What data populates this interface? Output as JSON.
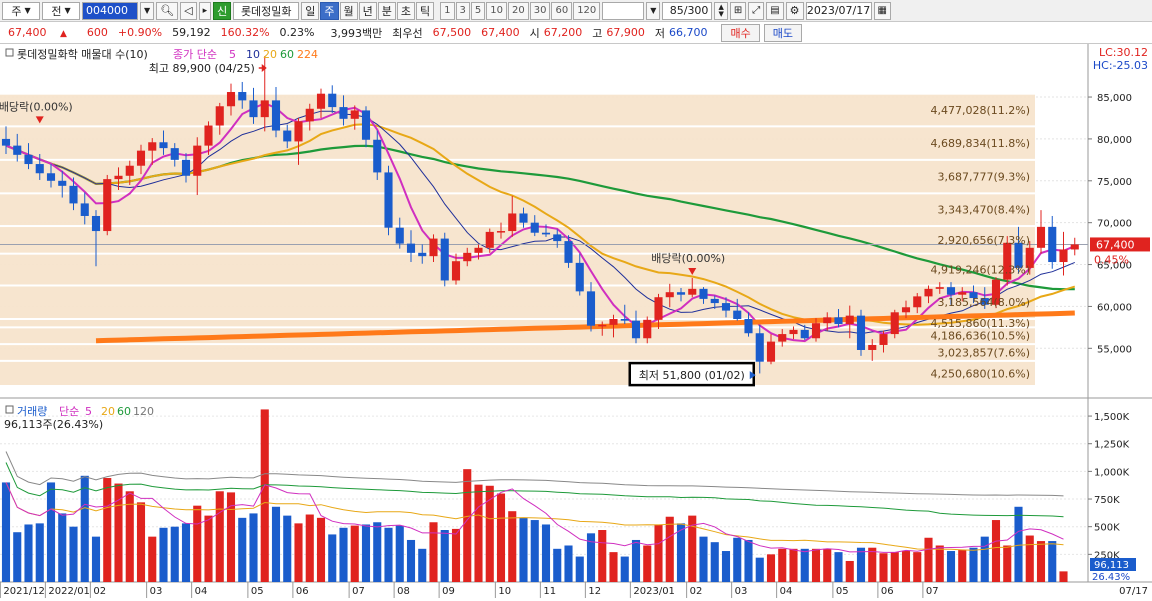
{
  "toolbar": {
    "market_type": "주",
    "market_sel": "전",
    "code": "004000",
    "credit_badge": "신",
    "stock_name": "롯데정밀화",
    "periods": [
      "일",
      "주",
      "월",
      "년",
      "분",
      "초",
      "틱"
    ],
    "active_period": "주",
    "intervals": [
      "1",
      "3",
      "5",
      "10",
      "20",
      "30",
      "60",
      "120"
    ],
    "count": "85/300",
    "date": "2023/07/17"
  },
  "quote": {
    "price": "67,400",
    "change": "600",
    "change_pct": "+0.90%",
    "volume": "59,192",
    "volume_ratio": "160.32%",
    "turnover": "0.23%",
    "amount": "3,993백만",
    "best_bid_label": "최우선",
    "best_ask": "67,500",
    "best_bid": "67,400",
    "open_label": "시",
    "open": "67,200",
    "high_label": "고",
    "high": "67,900",
    "low_label": "저",
    "low": "66,700",
    "buy_label": "매수",
    "sell_label": "매도"
  },
  "colors": {
    "up": "#e0231f",
    "down": "#1a5ccc",
    "ma5": "#d02fc0",
    "ma10": "#20309a",
    "ma20": "#e8a817",
    "ma60": "#1e9a3a",
    "ma224": "#ff7a1a",
    "vp_band": "#f7e4cc"
  },
  "chart_data": [
    {
      "type": "candlestick",
      "title": "롯데정밀화학 매물대 수(10)",
      "legend": [
        {
          "name": "종가 단순",
          "color": "#d02fc0"
        },
        {
          "name": "5",
          "color": "#d02fc0"
        },
        {
          "name": "10",
          "color": "#20309a"
        },
        {
          "name": "20",
          "color": "#e8a817"
        },
        {
          "name": "60",
          "color": "#1e9a3a"
        },
        {
          "name": "224",
          "color": "#ff7a1a"
        }
      ],
      "ylim": [
        50500,
        89900
      ],
      "yticks": [
        55000,
        60000,
        65000,
        70000,
        75000,
        80000,
        85000
      ],
      "ytick_labels": [
        "55,000",
        "60,000",
        "65,000",
        "70,000",
        "75,000",
        "80,000",
        "85,000"
      ],
      "lc_label": "LC:30.12",
      "hc_label": "HC:-25.03",
      "current_price_label": "67,400",
      "current_pct_label": "0.45%",
      "current_price": 67400,
      "candles": [
        [
          80000,
          81500,
          78200,
          79200
        ],
        [
          79200,
          80600,
          77300,
          78100
        ],
        [
          78100,
          79500,
          76400,
          77000
        ],
        [
          77000,
          78200,
          75100,
          75900
        ],
        [
          75900,
          77000,
          74200,
          75000
        ],
        [
          75000,
          76200,
          73000,
          74400
        ],
        [
          74400,
          75400,
          71500,
          72300
        ],
        [
          72300,
          73600,
          69800,
          70800
        ],
        [
          70800,
          71500,
          64800,
          69000
        ],
        [
          69000,
          75700,
          68500,
          75200
        ],
        [
          75200,
          76600,
          73900,
          75600
        ],
        [
          75600,
          77400,
          74500,
          76800
        ],
        [
          76800,
          79300,
          75800,
          78600
        ],
        [
          78600,
          80100,
          76900,
          79600
        ],
        [
          79600,
          81000,
          78100,
          78900
        ],
        [
          78900,
          79500,
          76700,
          77500
        ],
        [
          77500,
          78300,
          74800,
          75600
        ],
        [
          75600,
          80200,
          73300,
          79200
        ],
        [
          79200,
          82100,
          78100,
          81600
        ],
        [
          81600,
          84300,
          80500,
          83900
        ],
        [
          83900,
          86600,
          82800,
          85600
        ],
        [
          85600,
          86800,
          83600,
          84600
        ],
        [
          84600,
          86100,
          81800,
          82600
        ],
        [
          82600,
          89900,
          80900,
          84600
        ],
        [
          84600,
          86200,
          80200,
          81000
        ],
        [
          81000,
          81700,
          78900,
          79700
        ],
        [
          79700,
          82500,
          76900,
          82100
        ],
        [
          82100,
          84200,
          81000,
          83600
        ],
        [
          83600,
          86000,
          82500,
          85400
        ],
        [
          85400,
          86400,
          83100,
          83800
        ],
        [
          83800,
          85200,
          81600,
          82400
        ],
        [
          82400,
          84000,
          81100,
          83400
        ],
        [
          83400,
          83900,
          79000,
          79900
        ],
        [
          79900,
          81000,
          75100,
          76000
        ],
        [
          76000,
          76800,
          68500,
          69400
        ],
        [
          69400,
          70600,
          66900,
          67500
        ],
        [
          67500,
          69100,
          65300,
          66400
        ],
        [
          66400,
          67400,
          65100,
          66000
        ],
        [
          66000,
          68600,
          65300,
          68100
        ],
        [
          68100,
          68800,
          62400,
          63100
        ],
        [
          63100,
          66300,
          62600,
          65400
        ],
        [
          65400,
          67000,
          64800,
          66400
        ],
        [
          66400,
          67400,
          65600,
          67000
        ],
        [
          67000,
          69300,
          66400,
          68900
        ],
        [
          68900,
          70000,
          68100,
          69000
        ],
        [
          69000,
          73200,
          68300,
          71100
        ],
        [
          71100,
          71800,
          69400,
          70000
        ],
        [
          70000,
          70900,
          68400,
          68800
        ],
        [
          68800,
          69800,
          68300,
          68600
        ],
        [
          68600,
          69200,
          67000,
          67800
        ],
        [
          67800,
          68500,
          64600,
          65200
        ],
        [
          65200,
          66300,
          61300,
          61800
        ],
        [
          61800,
          62900,
          57000,
          57700
        ],
        [
          57700,
          58200,
          56500,
          57800
        ],
        [
          57800,
          59000,
          56300,
          58500
        ],
        [
          58500,
          60200,
          57900,
          58300
        ],
        [
          58300,
          59500,
          55600,
          56200
        ],
        [
          56200,
          58800,
          55600,
          58400
        ],
        [
          58400,
          61500,
          57300,
          61100
        ],
        [
          61100,
          62700,
          59900,
          61700
        ],
        [
          61700,
          62200,
          60600,
          61400
        ],
        [
          61400,
          63400,
          61100,
          62100
        ],
        [
          62100,
          62300,
          60300,
          60900
        ],
        [
          60900,
          61300,
          59700,
          60400
        ],
        [
          60400,
          61100,
          58700,
          59500
        ],
        [
          59500,
          60900,
          58300,
          58500
        ],
        [
          58500,
          59300,
          56400,
          56800
        ],
        [
          56800,
          57800,
          52000,
          53400
        ],
        [
          53400,
          56700,
          53100,
          55800
        ],
        [
          55800,
          57300,
          55200,
          56700
        ],
        [
          56700,
          57600,
          56100,
          57200
        ],
        [
          57200,
          57800,
          56000,
          56200
        ],
        [
          56200,
          58600,
          55800,
          58000
        ],
        [
          58000,
          59300,
          57100,
          58700
        ],
        [
          58700,
          59700,
          57500,
          57900
        ],
        [
          57900,
          60100,
          56200,
          58900
        ],
        [
          58900,
          59600,
          54100,
          54800
        ],
        [
          54800,
          56100,
          53500,
          55400
        ],
        [
          55400,
          57100,
          54500,
          56700
        ],
        [
          56700,
          59600,
          56200,
          59300
        ],
        [
          59300,
          60700,
          58600,
          59900
        ],
        [
          59900,
          61600,
          59200,
          61200
        ],
        [
          61200,
          62500,
          60400,
          62100
        ],
        [
          62100,
          62900,
          61500,
          62300
        ],
        [
          62300,
          62900,
          60200,
          61400
        ],
        [
          61400,
          62300,
          60600,
          61700
        ],
        [
          61700,
          62500,
          60400,
          61000
        ],
        [
          61000,
          62300,
          59700,
          60200
        ],
        [
          60200,
          63500,
          59800,
          63200
        ],
        [
          63200,
          68400,
          62500,
          67600
        ],
        [
          67600,
          69500,
          63900,
          64600
        ],
        [
          64600,
          67800,
          63800,
          67000
        ],
        [
          67000,
          71500,
          66300,
          69500
        ],
        [
          69500,
          70800,
          64500,
          65300
        ],
        [
          65300,
          68900,
          63700,
          66800
        ],
        [
          66800,
          68200,
          66100,
          67400
        ]
      ],
      "volume_profile": [
        {
          "label": "4,477,028(11.2%)",
          "low": 81500,
          "high": 85400
        },
        {
          "label": "4,689,834(11.8%)",
          "low": 77500,
          "high": 81500
        },
        {
          "label": "3,687,777(9.3%)",
          "low": 73500,
          "high": 77500
        },
        {
          "label": "3,343,470(8.4%)",
          "low": 69600,
          "high": 73500
        },
        {
          "label": "2,920,656(7.3%)",
          "low": 66300,
          "high": 69600
        },
        {
          "label": "4,919,246(12.3%)",
          "low": 62500,
          "high": 66300
        },
        {
          "label": "3,185,564(8.0%)",
          "low": 58500,
          "high": 62500
        },
        {
          "label": "4,515,860(11.3%)",
          "low": 57500,
          "high": 58500
        },
        {
          "label": "4,186,636(10.5%)",
          "low": 55500,
          "high": 57500
        },
        {
          "label": "3,023,857(7.6%)",
          "low": 53500,
          "high": 55500
        },
        {
          "label": "4,250,680(10.6%)",
          "low": 50500,
          "high": 53500
        }
      ],
      "annotations": [
        {
          "text": "최고 89,900 (04/25)",
          "type": "high",
          "index": 23,
          "value": 89900
        },
        {
          "text": "최저 51,800 (01/02)",
          "type": "low",
          "index": 67,
          "value": 51800
        },
        {
          "text": "배당락(0.00%)",
          "type": "dividend",
          "index": 3,
          "value": 81500
        },
        {
          "text": "배당락(0.00%)",
          "type": "dividend",
          "index": 61,
          "value": 63400
        }
      ]
    },
    {
      "type": "bar",
      "title": "거래량",
      "legend": [
        {
          "name": "거래량",
          "color": "#1a5ccc"
        },
        {
          "name": "단순",
          "color": "#d02fc0"
        },
        {
          "name": "5",
          "color": "#d02fc0"
        },
        {
          "name": "20",
          "color": "#e8a817"
        },
        {
          "name": "60",
          "color": "#1e9a3a"
        },
        {
          "name": "120",
          "color": "#777777"
        }
      ],
      "last_label": "96,113주(26.43%)",
      "last_value_label": "96,113",
      "last_pct_label": "26.43%",
      "ylim": [
        0,
        1600000
      ],
      "yticks": [
        250000,
        500000,
        750000,
        1000000,
        1250000,
        1500000
      ],
      "ytick_labels": [
        "250K",
        "500K",
        "750K",
        "1,000K",
        "1,250K",
        "1,500K"
      ],
      "volumes": [
        900000,
        450000,
        520000,
        530000,
        900000,
        620000,
        500000,
        960000,
        410000,
        940000,
        890000,
        820000,
        720000,
        410000,
        490000,
        500000,
        530000,
        690000,
        600000,
        820000,
        810000,
        580000,
        620000,
        1560000,
        680000,
        600000,
        530000,
        610000,
        580000,
        430000,
        490000,
        510000,
        520000,
        540000,
        490000,
        510000,
        380000,
        300000,
        540000,
        470000,
        480000,
        1020000,
        880000,
        870000,
        800000,
        640000,
        580000,
        560000,
        520000,
        300000,
        330000,
        230000,
        440000,
        470000,
        270000,
        230000,
        380000,
        330000,
        520000,
        590000,
        530000,
        600000,
        410000,
        360000,
        280000,
        400000,
        380000,
        220000,
        250000,
        300000,
        300000,
        300000,
        300000,
        300000,
        270000,
        190000,
        310000,
        310000,
        260000,
        270000,
        280000,
        270000,
        400000,
        330000,
        280000,
        290000,
        310000,
        410000,
        560000,
        330000,
        680000,
        420000,
        370000,
        370000,
        96113
      ]
    }
  ],
  "x_axis": {
    "labels": [
      "2021/12",
      "2022/01",
      "02",
      "03",
      "04",
      "05",
      "06",
      "07",
      "08",
      "09",
      "10",
      "11",
      "12",
      "2023/01",
      "02",
      "03",
      "04",
      "05",
      "06",
      "07"
    ],
    "label_index": [
      0,
      4,
      8,
      13,
      17,
      22,
      26,
      31,
      35,
      39,
      44,
      48,
      52,
      56,
      61,
      65,
      69,
      74,
      78,
      82
    ],
    "current_label": "07/17"
  }
}
